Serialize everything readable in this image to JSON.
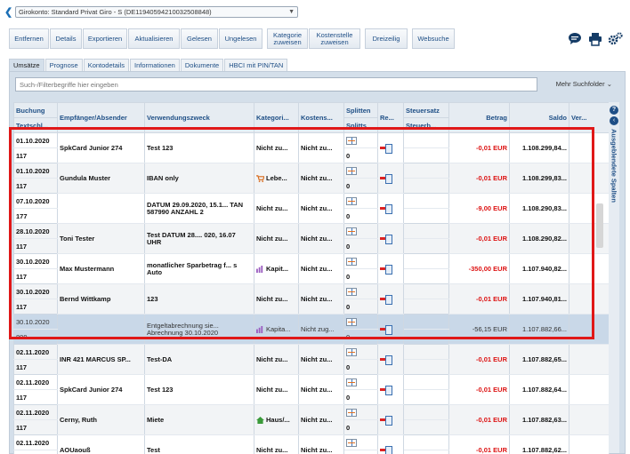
{
  "account": {
    "label": "Girokonto: Standard Privat Giro - S (DE11940594210032508848)"
  },
  "toolbar": [
    "Entfernen",
    "Details",
    "Exportieren",
    "Aktualisieren",
    "Gelesen",
    "Ungelesen",
    "Kategorie zuweisen",
    "Kostenstelle zuweisen",
    "Dreizeilig",
    "Websuche"
  ],
  "tabs": [
    "Umsätze",
    "Prognose",
    "Kontodetails",
    "Informationen",
    "Dokumente",
    "HBCI mit PIN/TAN"
  ],
  "search": {
    "placeholder": "Such-/Filterbegriffe hier eingeben"
  },
  "more_folders": "Mehr Suchfolder",
  "columns": {
    "buchung": "Buchung",
    "textschl": "Textschl...",
    "empf": "Empfänger/Absender",
    "zweck": "Verwendungszweck",
    "kat": "Kategori...",
    "kost": "Kostens...",
    "splitten": "Splitten",
    "splitts": "Splitts",
    "re": "Re...",
    "steuersatz": "Steuersatz",
    "steuerb": "Steuerb...",
    "betrag": "Betrag",
    "saldo": "Saldo",
    "ver": "Ver..."
  },
  "side_label": "Ausgeblendete Spalten",
  "icons": {
    "back": "back-arrow-icon",
    "chat": "comment-icon",
    "print": "print-icon",
    "settings": "gears-icon",
    "help": "help-icon",
    "collapse": "collapse-icon"
  },
  "rows": [
    {
      "date": "01.10.2020",
      "code": "117",
      "empf": "SpkCard Junior 274",
      "zweck": "Test 123",
      "kat": "Nicht zu...",
      "kost": "Nicht zu...",
      "splitts": "0",
      "betrag": "-0,01 EUR",
      "saldo": "1.108.299,84..."
    },
    {
      "date": "01.10.2020",
      "code": "117",
      "empf": "Gundula Muster",
      "zweck": "IBAN only",
      "kat": "Lebe...",
      "kat_icon": "shopping-cart-icon",
      "kost": "Nicht zu...",
      "splitts": "0",
      "betrag": "-0,01 EUR",
      "saldo": "1.108.299,83..."
    },
    {
      "date": "07.10.2020",
      "code": "177",
      "empf": "",
      "zweck": "DATUM 29.09.2020, 15.1... TAN 587990 ANZAHL 2",
      "kat": "Nicht zu...",
      "kost": "Nicht zu...",
      "splitts": "0",
      "betrag": "-9,00 EUR",
      "saldo": "1.108.290,83..."
    },
    {
      "date": "28.10.2020",
      "code": "117",
      "empf": "Toni Tester",
      "zweck": "Test DATUM 28.... 020, 16.07 UHR",
      "kat": "Nicht zu...",
      "kost": "Nicht zu...",
      "splitts": "0",
      "betrag": "-0,01 EUR",
      "saldo": "1.108.290,82..."
    },
    {
      "date": "30.10.2020",
      "code": "117",
      "empf": "Max Mustermann",
      "zweck": "monatlicher Sparbetrag f... s Auto",
      "kat": "Kapit...",
      "kat_icon": "bar-chart-icon",
      "kost": "Nicht zu...",
      "splitts": "0",
      "betrag": "-350,00 EUR",
      "saldo": "1.107.940,82..."
    },
    {
      "date": "30.10.2020",
      "code": "117",
      "empf": "Bernd Wittkamp",
      "zweck": "123",
      "kat": "Nicht zu...",
      "kost": "Nicht zu...",
      "splitts": "0",
      "betrag": "-0,01 EUR",
      "saldo": "1.107.940,81..."
    },
    {
      "date": "30.10.2020",
      "code": "809",
      "empf": "",
      "zweck": "Entgeltabrechnung sie... Abrechnung 30.10.2020",
      "kat": "Kapita...",
      "kat_icon": "bar-chart-icon",
      "kost": "Nicht zug...",
      "splitts": "0",
      "betrag": "-56,15 EUR",
      "saldo": "1.107.882,66...",
      "selected": true
    },
    {
      "date": "02.11.2020",
      "code": "117",
      "empf": "INR 421 MARCUS SP...",
      "zweck": "Test-DA",
      "kat": "Nicht zu...",
      "kost": "Nicht zu...",
      "splitts": "0",
      "betrag": "-0,01 EUR",
      "saldo": "1.107.882,65..."
    },
    {
      "date": "02.11.2020",
      "code": "117",
      "empf": "SpkCard Junior 274",
      "zweck": "Test 123",
      "kat": "Nicht zu...",
      "kost": "Nicht zu...",
      "splitts": "0",
      "betrag": "-0,01 EUR",
      "saldo": "1.107.882,64..."
    },
    {
      "date": "02.11.2020",
      "code": "117",
      "empf": "Cerny, Ruth",
      "zweck": "Miete",
      "kat": "Haus/...",
      "kat_icon": "house-icon",
      "kost": "Nicht zu...",
      "splitts": "0",
      "betrag": "-0,01 EUR",
      "saldo": "1.107.882,63..."
    },
    {
      "date": "02.11.2020",
      "code": "117",
      "empf": "AOUaouß",
      "zweck": "Test",
      "kat": "Nicht zu...",
      "kost": "Nicht zu...",
      "splitts": "0",
      "betrag": "-0,01 EUR",
      "saldo": "1.107.882,62..."
    }
  ]
}
